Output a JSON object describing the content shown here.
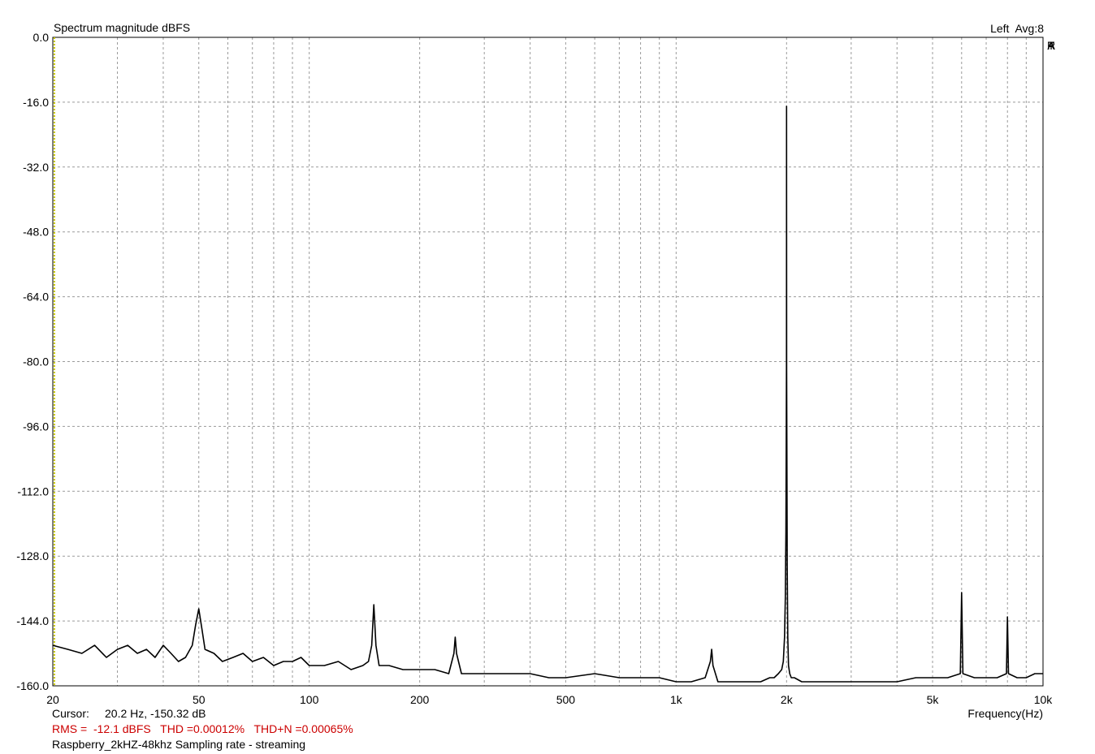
{
  "header": {
    "title": "Spectrum magnitude dBFS",
    "channel": "Left  Avg:8",
    "brand": [
      "A",
      "R",
      "T",
      "A"
    ]
  },
  "footer": {
    "cursor_label": "Cursor:",
    "cursor_value": "20.2 Hz, -150.32 dB",
    "rms_line": "RMS =  -12.1 dBFS   THD =0.00012%   THD+N =0.00065%",
    "file_line": "Raspberry_2kHZ-48khz Sampling rate - streaming"
  },
  "colors": {
    "trace": "#000000",
    "grid": "#9a9a9a",
    "stats": "#cc0000",
    "cursor": "#c8c800"
  },
  "chart_data": {
    "type": "line",
    "title": "Spectrum magnitude dBFS",
    "xlabel": "Frequency(Hz)",
    "ylabel": "",
    "xscale": "log",
    "xlim": [
      20,
      10000
    ],
    "ylim": [
      -160,
      0
    ],
    "grid": true,
    "x_ticks": [
      {
        "v": 20,
        "label": "20"
      },
      {
        "v": 50,
        "label": "50"
      },
      {
        "v": 100,
        "label": "100"
      },
      {
        "v": 200,
        "label": "200"
      },
      {
        "v": 500,
        "label": "500"
      },
      {
        "v": 1000,
        "label": "1k"
      },
      {
        "v": 2000,
        "label": "2k"
      },
      {
        "v": 5000,
        "label": "5k"
      },
      {
        "v": 10000,
        "label": "10k"
      }
    ],
    "y_ticks": [
      {
        "v": 0,
        "label": "0.0"
      },
      {
        "v": -16,
        "label": "-16.0"
      },
      {
        "v": -32,
        "label": "-32.0"
      },
      {
        "v": -48,
        "label": "-48.0"
      },
      {
        "v": -64,
        "label": "-64.0"
      },
      {
        "v": -80,
        "label": "-80.0"
      },
      {
        "v": -96,
        "label": "-96.0"
      },
      {
        "v": -112,
        "label": "-112.0"
      },
      {
        "v": -128,
        "label": "-128.0"
      },
      {
        "v": -144,
        "label": "-144.0"
      },
      {
        "v": -160,
        "label": "-160.0"
      }
    ],
    "cursor": {
      "x": 20.2,
      "y": -150.32
    },
    "series": [
      {
        "x": [
          20,
          22,
          24,
          26,
          28,
          30,
          32,
          34,
          36,
          38,
          40,
          42,
          44,
          46,
          48,
          49,
          50,
          51,
          52,
          55,
          58,
          62,
          66,
          70,
          75,
          80,
          85,
          90,
          95,
          100,
          110,
          120,
          130,
          140,
          145,
          148,
          150,
          152,
          155,
          165,
          180,
          200,
          220,
          240,
          248,
          250,
          252,
          260,
          300,
          350,
          400,
          450,
          500,
          600,
          700,
          800,
          900,
          1000,
          1100,
          1200,
          1240,
          1250,
          1260,
          1300,
          1400,
          1500,
          1600,
          1700,
          1800,
          1850,
          1900,
          1940,
          1960,
          1975,
          1985,
          1992,
          1996,
          1999,
          2000,
          2001,
          2004,
          2008,
          2015,
          2025,
          2040,
          2060,
          2100,
          2200,
          2400,
          2600,
          2800,
          3000,
          3300,
          3600,
          4000,
          4500,
          5000,
          5500,
          5950,
          6000,
          6050,
          6500,
          7000,
          7500,
          7950,
          8000,
          8050,
          8500,
          9000,
          9500,
          10000
        ],
        "y": [
          -150,
          -151,
          -152,
          -150,
          -153,
          -151,
          -150,
          -152,
          -151,
          -153,
          -150,
          -152,
          -154,
          -153,
          -150,
          -145,
          -141,
          -146,
          -151,
          -152,
          -154,
          -153,
          -152,
          -154,
          -153,
          -155,
          -154,
          -154,
          -153,
          -155,
          -155,
          -154,
          -156,
          -155,
          -154,
          -150,
          -140,
          -150,
          -155,
          -155,
          -156,
          -156,
          -156,
          -157,
          -152,
          -148,
          -152,
          -157,
          -157,
          -157,
          -157,
          -158,
          -158,
          -157,
          -158,
          -158,
          -158,
          -159,
          -159,
          -158,
          -154,
          -151,
          -155,
          -159,
          -159,
          -159,
          -159,
          -159,
          -158,
          -158,
          -157,
          -156,
          -154,
          -148,
          -138,
          -122,
          -100,
          -80,
          -17,
          -82,
          -102,
          -130,
          -148,
          -155,
          -157,
          -158,
          -158,
          -159,
          -159,
          -159,
          -159,
          -159,
          -159,
          -159,
          -159,
          -158,
          -158,
          -158,
          -157,
          -137,
          -157,
          -158,
          -158,
          -158,
          -157,
          -143,
          -157,
          -158,
          -158,
          -157,
          -157
        ]
      }
    ]
  }
}
